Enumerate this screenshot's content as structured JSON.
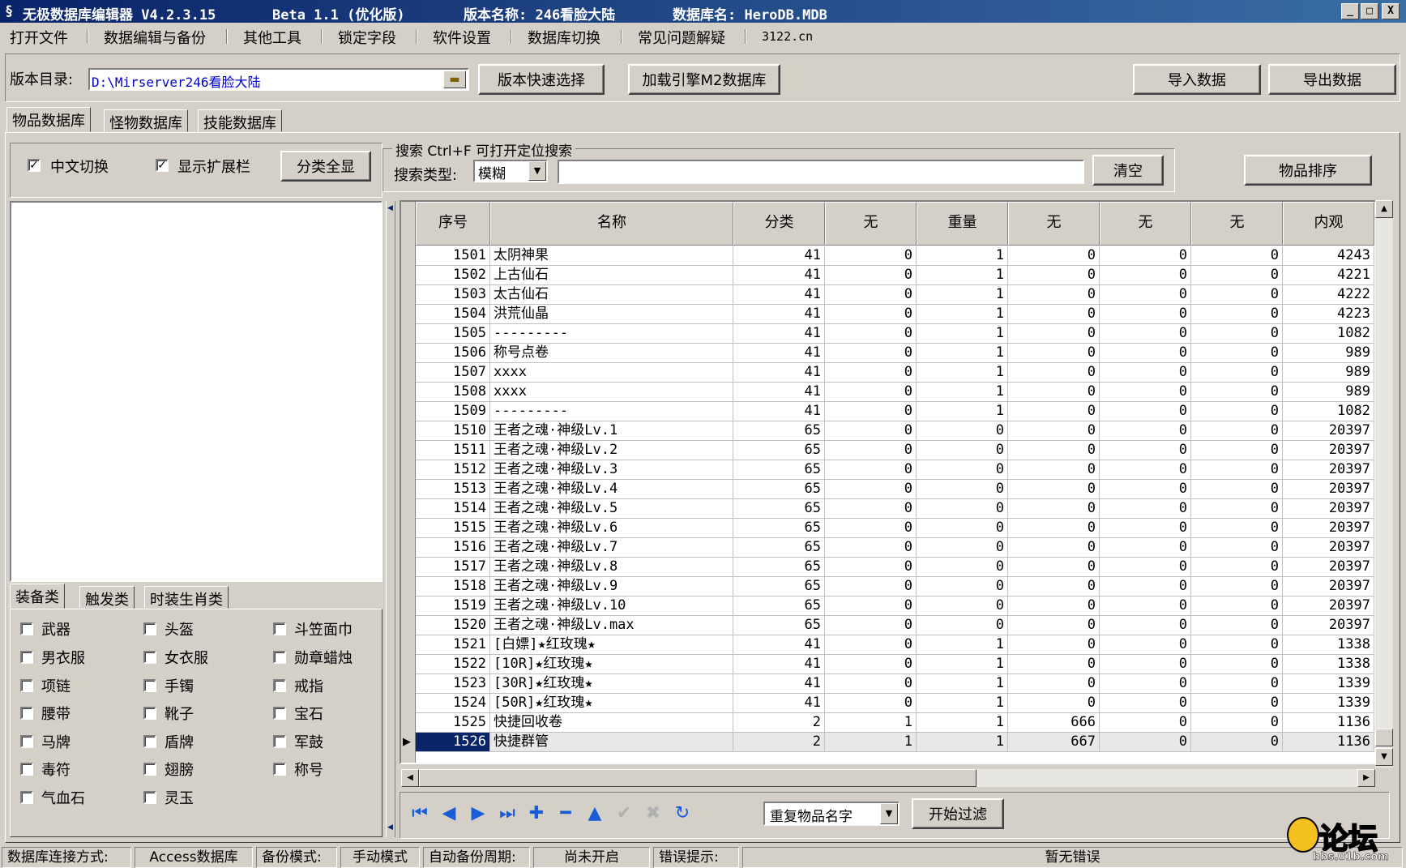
{
  "window": {
    "app_title": "无极数据库编辑器 V4.2.3.15",
    "beta": "Beta 1.1 (优化版)",
    "version_name": "版本名称: 246看脸大陆",
    "db_name": "数据库名: HeroDB.MDB",
    "minimize": "_",
    "maximize": "□",
    "close": "X"
  },
  "menu": [
    "打开文件",
    "数据编辑与备份",
    "其他工具",
    "锁定字段",
    "软件设置",
    "数据库切换",
    "常见问题解疑",
    "3122.cn"
  ],
  "toolbar": {
    "dir_label": "版本目录:",
    "dir_value": "D:\\Mirserver246看脸大陆",
    "quick_select": "版本快速选择",
    "load_m2": "加载引擎M2数据库",
    "import": "导入数据",
    "export": "导出数据"
  },
  "db_tabs": [
    "物品数据库",
    "怪物数据库",
    "技能数据库"
  ],
  "options": {
    "chinese_switch": "中文切换",
    "show_ext": "显示扩展栏",
    "show_all_categories": "分类全显",
    "check_mark": "✓"
  },
  "search": {
    "group_title": "搜索  Ctrl+F 可打开定位搜索",
    "type_label": "搜索类型:",
    "type_value": "模糊",
    "query": "",
    "clear": "清空",
    "sort": "物品排序"
  },
  "category_tabs": [
    "装备类",
    "触发类",
    "时装生肖类"
  ],
  "categories": [
    [
      "武器",
      "头盔",
      "斗笠面巾"
    ],
    [
      "男衣服",
      "女衣服",
      "勋章蜡烛"
    ],
    [
      "项链",
      "手镯",
      "戒指"
    ],
    [
      "腰带",
      "靴子",
      "宝石"
    ],
    [
      "马牌",
      "盾牌",
      "军鼓"
    ],
    [
      "毒符",
      "翅膀",
      "称号"
    ],
    [
      "气血石",
      "灵玉",
      ""
    ]
  ],
  "grid": {
    "columns": [
      "序号",
      "名称",
      "分类",
      "无",
      "重量",
      "无",
      "无",
      "无",
      "内观"
    ],
    "rows": [
      [
        "1501",
        "太阴神果",
        "41",
        "0",
        "1",
        "0",
        "0",
        "0",
        "4243"
      ],
      [
        "1502",
        "上古仙石",
        "41",
        "0",
        "1",
        "0",
        "0",
        "0",
        "4221"
      ],
      [
        "1503",
        "太古仙石",
        "41",
        "0",
        "1",
        "0",
        "0",
        "0",
        "4222"
      ],
      [
        "1504",
        "洪荒仙晶",
        "41",
        "0",
        "1",
        "0",
        "0",
        "0",
        "4223"
      ],
      [
        "1505",
        "---------",
        "41",
        "0",
        "1",
        "0",
        "0",
        "0",
        "1082"
      ],
      [
        "1506",
        "称号点卷",
        "41",
        "0",
        "1",
        "0",
        "0",
        "0",
        "989"
      ],
      [
        "1507",
        "xxxx",
        "41",
        "0",
        "1",
        "0",
        "0",
        "0",
        "989"
      ],
      [
        "1508",
        "xxxx",
        "41",
        "0",
        "1",
        "0",
        "0",
        "0",
        "989"
      ],
      [
        "1509",
        "---------",
        "41",
        "0",
        "1",
        "0",
        "0",
        "0",
        "1082"
      ],
      [
        "1510",
        "王者之魂·神级Lv.1",
        "65",
        "0",
        "0",
        "0",
        "0",
        "0",
        "20397"
      ],
      [
        "1511",
        "王者之魂·神级Lv.2",
        "65",
        "0",
        "0",
        "0",
        "0",
        "0",
        "20397"
      ],
      [
        "1512",
        "王者之魂·神级Lv.3",
        "65",
        "0",
        "0",
        "0",
        "0",
        "0",
        "20397"
      ],
      [
        "1513",
        "王者之魂·神级Lv.4",
        "65",
        "0",
        "0",
        "0",
        "0",
        "0",
        "20397"
      ],
      [
        "1514",
        "王者之魂·神级Lv.5",
        "65",
        "0",
        "0",
        "0",
        "0",
        "0",
        "20397"
      ],
      [
        "1515",
        "王者之魂·神级Lv.6",
        "65",
        "0",
        "0",
        "0",
        "0",
        "0",
        "20397"
      ],
      [
        "1516",
        "王者之魂·神级Lv.7",
        "65",
        "0",
        "0",
        "0",
        "0",
        "0",
        "20397"
      ],
      [
        "1517",
        "王者之魂·神级Lv.8",
        "65",
        "0",
        "0",
        "0",
        "0",
        "0",
        "20397"
      ],
      [
        "1518",
        "王者之魂·神级Lv.9",
        "65",
        "0",
        "0",
        "0",
        "0",
        "0",
        "20397"
      ],
      [
        "1519",
        "王者之魂·神级Lv.10",
        "65",
        "0",
        "0",
        "0",
        "0",
        "0",
        "20397"
      ],
      [
        "1520",
        "王者之魂·神级Lv.max",
        "65",
        "0",
        "0",
        "0",
        "0",
        "0",
        "20397"
      ],
      [
        "1521",
        "[白嫖]★红玫瑰★",
        "41",
        "0",
        "1",
        "0",
        "0",
        "0",
        "1338"
      ],
      [
        "1522",
        "[10R]★红玫瑰★",
        "41",
        "0",
        "1",
        "0",
        "0",
        "0",
        "1338"
      ],
      [
        "1523",
        "[30R]★红玫瑰★",
        "41",
        "0",
        "1",
        "0",
        "0",
        "0",
        "1339"
      ],
      [
        "1524",
        "[50R]★红玫瑰★",
        "41",
        "0",
        "1",
        "0",
        "0",
        "0",
        "1339"
      ],
      [
        "1525",
        "快捷回收卷",
        "2",
        "1",
        "1",
        "666",
        "0",
        "0",
        "1136"
      ],
      [
        "1526",
        "快捷群管",
        "2",
        "1",
        "1",
        "667",
        "0",
        "0",
        "1136"
      ]
    ],
    "selected_index": 25
  },
  "bottom": {
    "filter_value": "重复物品名字",
    "start_filter": "开始过滤"
  },
  "status": {
    "conn_label": "数据库连接方式:",
    "conn_value": "Access数据库",
    "backup_label": "备份模式:",
    "backup_value": "手动模式",
    "auto_label": "自动备份周期:",
    "auto_value": "尚未开启",
    "err_label": "错误提示:",
    "err_value": "暂无错误"
  },
  "watermark": {
    "text": "论坛",
    "url": "bbs.01b.com"
  },
  "colors": {
    "title_start": "#0a246a",
    "title_end": "#3a6ea5",
    "selection": "#0a246a",
    "nav_icon": "#1a5bd8",
    "path_text": "#0000cc"
  }
}
